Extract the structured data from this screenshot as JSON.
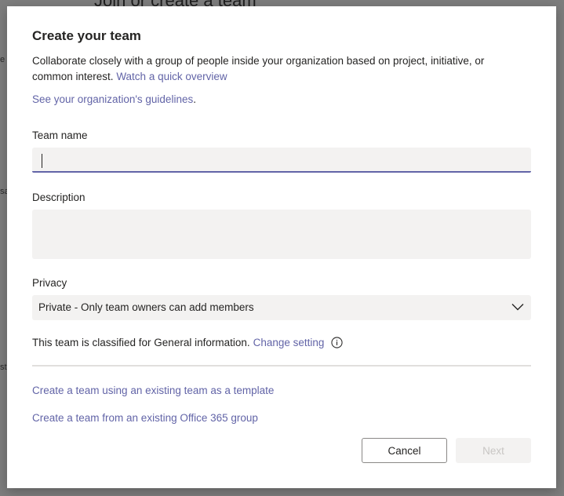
{
  "background": {
    "heading": "Join or create a team",
    "fragments": [
      "e",
      "sa",
      "st"
    ]
  },
  "dialog": {
    "title": "Create your team",
    "intro_text": "Collaborate closely with a group of people inside your organization based on project, initiative, or common interest.",
    "intro_link": "Watch a quick overview",
    "guidelines_link": "See your organization's guidelines",
    "guidelines_period": ".",
    "team_name": {
      "label": "Team name",
      "value": ""
    },
    "description": {
      "label": "Description",
      "value": ""
    },
    "privacy": {
      "label": "Privacy",
      "selected": "Private - Only team owners can add members",
      "icon": "chevron-down-icon"
    },
    "classification": {
      "text": "This team is classified for General information.",
      "link": "Change setting",
      "icon": "info-icon"
    },
    "template_link": "Create a team using an existing team as a template",
    "office_group_link": "Create a team from an existing Office 365 group",
    "buttons": {
      "cancel": "Cancel",
      "next": "Next"
    }
  },
  "colors": {
    "accent": "#6264a7",
    "overlay": "#7d7d7d",
    "field_background": "#f3f2f1",
    "disabled_text": "#c8c6c4"
  }
}
